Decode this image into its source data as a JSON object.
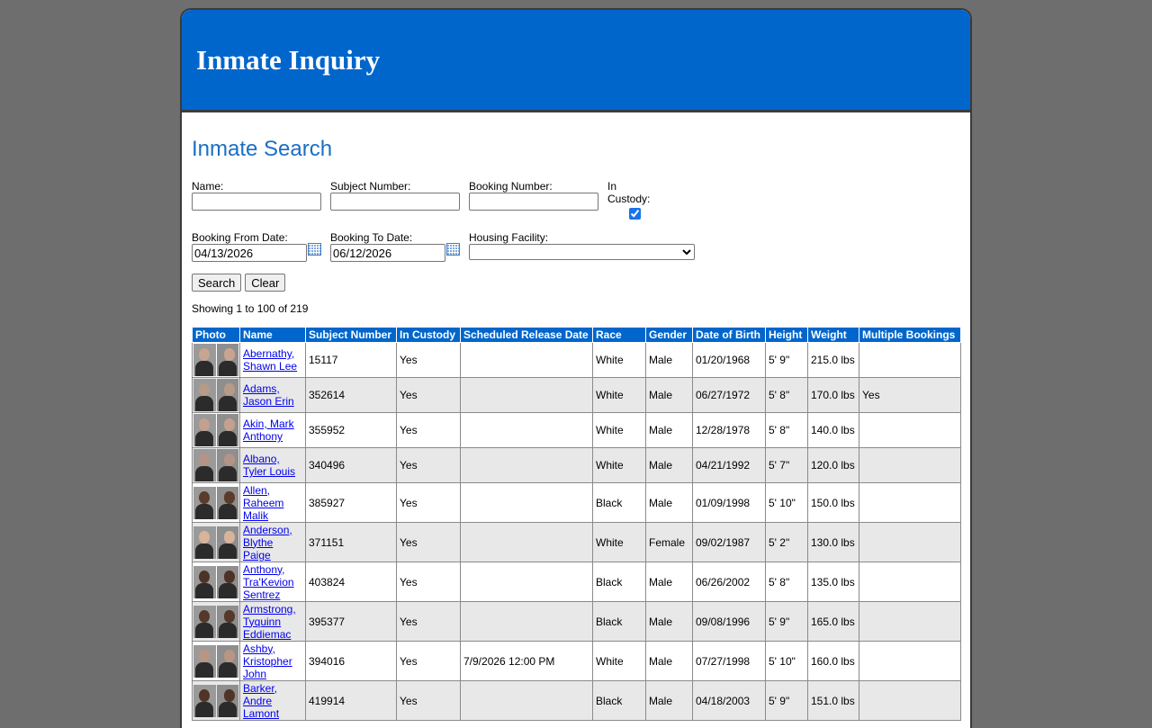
{
  "header": {
    "title": "Inmate Inquiry"
  },
  "page_title": "Inmate Search",
  "form": {
    "name_label": "Name:",
    "subject_label": "Subject Number:",
    "booking_label": "Booking Number:",
    "custody_label": "In Custody:",
    "custody_checked": true,
    "from_label": "Booking From Date:",
    "from_value": "04/13/2026",
    "to_label": "Booking To Date:",
    "to_value": "06/12/2026",
    "facility_label": "Housing Facility:",
    "facility_value": "",
    "search_button": "Search",
    "clear_button": "Clear",
    "calendar_icon": "calendar-icon"
  },
  "showing": "Showing 1 to 100 of 219",
  "table": {
    "headers": [
      "Photo",
      "Name",
      "Subject Number",
      "In Custody",
      "Scheduled Release Date",
      "Race",
      "Gender",
      "Date of Birth",
      "Height",
      "Weight",
      "Multiple Bookings"
    ],
    "rows": [
      {
        "name_lines": [
          "Abernathy,",
          "Shawn Lee"
        ],
        "subject": "15117",
        "custody": "Yes",
        "release": "",
        "race": "White",
        "gender": "Male",
        "dob": "01/20/1968",
        "height": "5' 9\"",
        "weight": "215.0 lbs",
        "multiple": "",
        "skin": "#c9a591"
      },
      {
        "name_lines": [
          "Adams,",
          "Jason Erin"
        ],
        "subject": "352614",
        "custody": "Yes",
        "release": "",
        "race": "White",
        "gender": "Male",
        "dob": "06/27/1972",
        "height": "5' 8\"",
        "weight": "170.0 lbs",
        "multiple": "Yes",
        "skin": "#b89a88"
      },
      {
        "name_lines": [
          "Akin, Mark",
          "Anthony"
        ],
        "subject": "355952",
        "custody": "Yes",
        "release": "",
        "race": "White",
        "gender": "Male",
        "dob": "12/28/1978",
        "height": "5' 8\"",
        "weight": "140.0 lbs",
        "multiple": "",
        "skin": "#c4a08e"
      },
      {
        "name_lines": [
          "Albano,",
          "Tyler Louis"
        ],
        "subject": "340496",
        "custody": "Yes",
        "release": "",
        "race": "White",
        "gender": "Male",
        "dob": "04/21/1992",
        "height": "5' 7\"",
        "weight": "120.0 lbs",
        "multiple": "",
        "skin": "#b39486"
      },
      {
        "name_lines": [
          "Allen,",
          "Raheem",
          "Malik"
        ],
        "subject": "385927",
        "custody": "Yes",
        "release": "",
        "race": "Black",
        "gender": "Male",
        "dob": "01/09/1998",
        "height": "5' 10\"",
        "weight": "150.0 lbs",
        "multiple": "",
        "skin": "#5a3b2c"
      },
      {
        "name_lines": [
          "Anderson,",
          "Blythe",
          "Paige"
        ],
        "subject": "371151",
        "custody": "Yes",
        "release": "",
        "race": "White",
        "gender": "Female",
        "dob": "09/02/1987",
        "height": "5' 2\"",
        "weight": "130.0 lbs",
        "multiple": "",
        "skin": "#d8b49a"
      },
      {
        "name_lines": [
          "Anthony,",
          "Tra'Kevion",
          "Sentrez"
        ],
        "subject": "403824",
        "custody": "Yes",
        "release": "",
        "race": "Black",
        "gender": "Male",
        "dob": "06/26/2002",
        "height": "5' 8\"",
        "weight": "135.0 lbs",
        "multiple": "",
        "skin": "#4d3326"
      },
      {
        "name_lines": [
          "Armstrong,",
          "Tyquinn",
          "Eddiemac"
        ],
        "subject": "395377",
        "custody": "Yes",
        "release": "",
        "race": "Black",
        "gender": "Male",
        "dob": "09/08/1996",
        "height": "5' 9\"",
        "weight": "165.0 lbs",
        "multiple": "",
        "skin": "#553829"
      },
      {
        "name_lines": [
          "Ashby,",
          "Kristopher",
          "John"
        ],
        "subject": "394016",
        "custody": "Yes",
        "release": "7/9/2026 12:00 PM",
        "race": "White",
        "gender": "Male",
        "dob": "07/27/1998",
        "height": "5' 10\"",
        "weight": "160.0 lbs",
        "multiple": "",
        "skin": "#b99683"
      },
      {
        "name_lines": [
          "Barker,",
          "Andre",
          "Lamont"
        ],
        "subject": "419914",
        "custody": "Yes",
        "release": "",
        "race": "Black",
        "gender": "Male",
        "dob": "04/18/2003",
        "height": "5' 9\"",
        "weight": "151.0 lbs",
        "multiple": "",
        "skin": "#4f3527"
      }
    ]
  }
}
